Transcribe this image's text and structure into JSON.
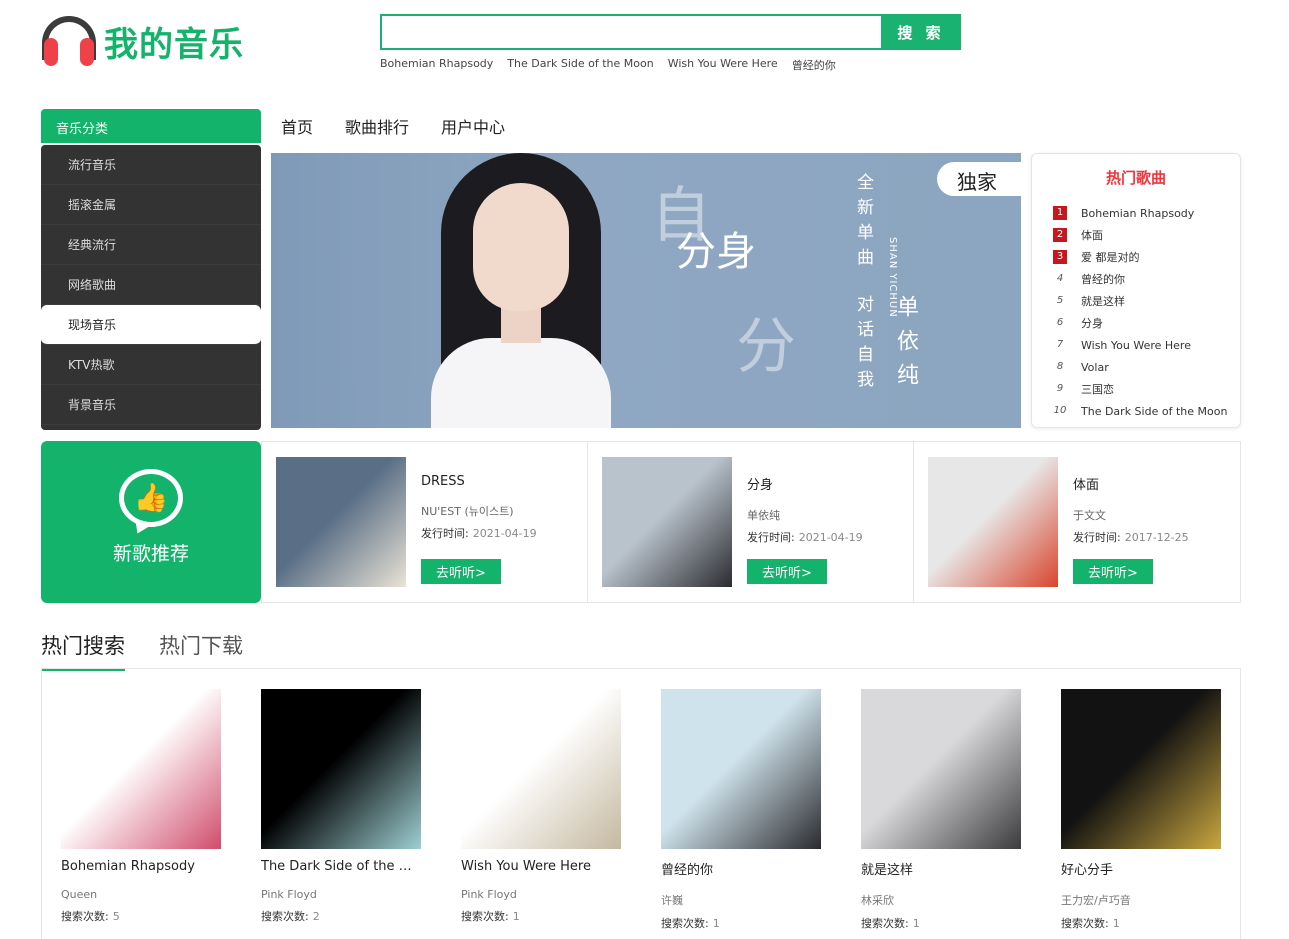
{
  "header": {
    "logo_text": "我的音乐",
    "search_button": "搜 索",
    "search_placeholder": "",
    "hot_keywords": [
      "Bohemian Rhapsody",
      "The Dark Side of the Moon",
      "Wish You Were Here",
      "曾经的你"
    ]
  },
  "categories": {
    "title": "音乐分类",
    "items": [
      "流行音乐",
      "摇滚金属",
      "经典流行",
      "网络歌曲",
      "现场音乐",
      "KTV热歌",
      "背景音乐"
    ]
  },
  "nav": [
    "首页",
    "歌曲排行",
    "用户中心"
  ],
  "banner": {
    "exclusive": "独家",
    "title": "分身",
    "vertical_1": "全新单曲",
    "vertical_2": "对话自我",
    "artist_cn": "单依纯",
    "artist_en": "SHAN YICHUN"
  },
  "hot_songs": {
    "title": "热门歌曲",
    "items": [
      {
        "rank": "1",
        "name": "Bohemian Rhapsody"
      },
      {
        "rank": "2",
        "name": "体面"
      },
      {
        "rank": "3",
        "name": "爱 都是对的"
      },
      {
        "rank": "4",
        "name": "曾经的你"
      },
      {
        "rank": "5",
        "name": "就是这样"
      },
      {
        "rank": "6",
        "name": "分身"
      },
      {
        "rank": "7",
        "name": "Wish You Were Here"
      },
      {
        "rank": "8",
        "name": "Volar"
      },
      {
        "rank": "9",
        "name": "三国恋"
      },
      {
        "rank": "10",
        "name": "The Dark Side of the Moon"
      }
    ]
  },
  "new_songs": {
    "title": "新歌推荐",
    "date_label": "发行时间:",
    "listen_label": "去听听>",
    "items": [
      {
        "name": "DRESS",
        "artist": "NU'EST (뉴이스트)",
        "date": "2021-04-19",
        "cover_colors": [
          "#5a6f86",
          "#e9e3d6"
        ]
      },
      {
        "name": "分身",
        "artist": "单依纯",
        "date": "2021-04-19",
        "cover_colors": [
          "#b9c3cc",
          "#2b2b30"
        ]
      },
      {
        "name": "体面",
        "artist": "于文文",
        "date": "2017-12-25",
        "cover_colors": [
          "#e7e7e7",
          "#d8452d"
        ]
      }
    ]
  },
  "tabs": [
    "热门搜索",
    "热门下载"
  ],
  "hot_search": {
    "count_label": "搜索次数:",
    "items": [
      {
        "name": "Bohemian Rhapsody",
        "artist": "Queen",
        "count": "5",
        "cover_colors": [
          "#ffffff",
          "#d04d6c"
        ]
      },
      {
        "name": "The Dark Side of the Mo...",
        "artist": "Pink Floyd",
        "count": "2",
        "cover_colors": [
          "#000000",
          "#9ecfd3"
        ]
      },
      {
        "name": "Wish You Were Here",
        "artist": "Pink Floyd",
        "count": "1",
        "cover_colors": [
          "#ffffff",
          "#c4b89f"
        ]
      },
      {
        "name": "曾经的你",
        "artist": "许巍",
        "count": "1",
        "cover_colors": [
          "#cfe3ec",
          "#2a2a2e"
        ]
      },
      {
        "name": "就是这样",
        "artist": "林采欣",
        "count": "1",
        "cover_colors": [
          "#d9d9db",
          "#3b3b3d"
        ]
      },
      {
        "name": "好心分手",
        "artist": "王力宏/卢巧音",
        "count": "1",
        "cover_colors": [
          "#121212",
          "#c9a640"
        ]
      }
    ]
  },
  "colors": {
    "brand_green": "#13b36c",
    "hot_red": "#f2353c"
  }
}
